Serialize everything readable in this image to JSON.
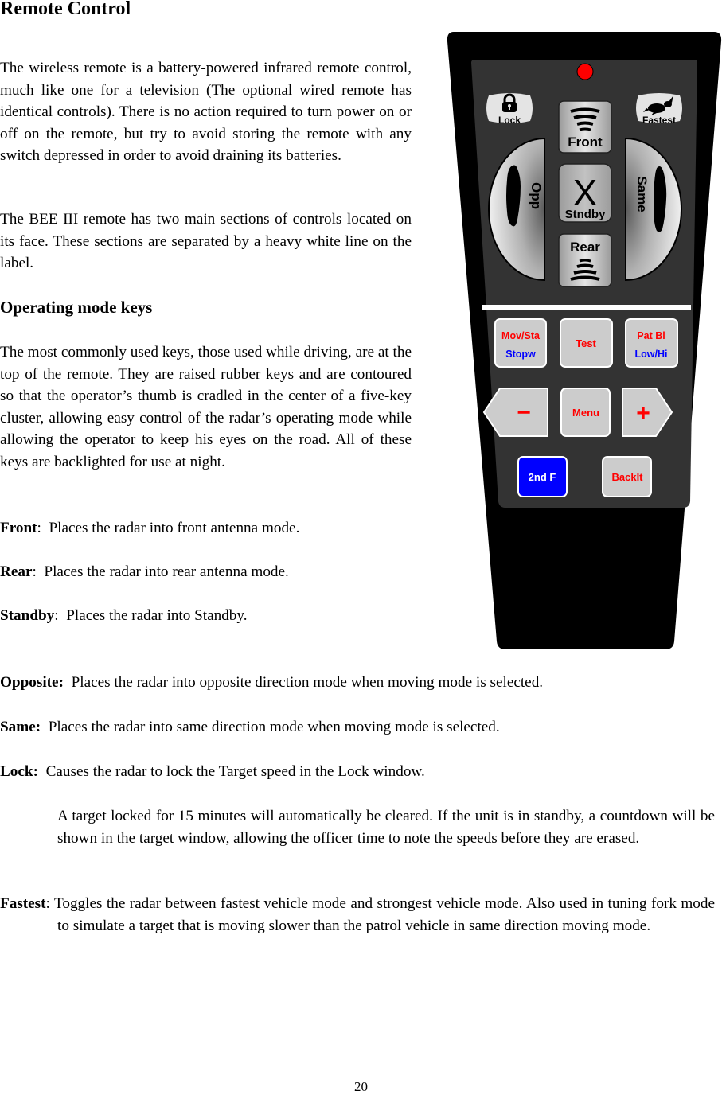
{
  "title": "Remote Control",
  "intro_paragraphs": [
    "The wireless remote is a battery-powered infrared remote control, much like one for a television (The optional wired remote has identical controls). There is no action required to turn power on or off on the remote, but try to avoid storing the remote with any switch depressed in order to avoid draining its batteries.",
    "The BEE III remote has two main sections of controls located on its face. These sections are separated by a heavy white line on the label."
  ],
  "section_heading": "Operating mode keys",
  "section_paragraph": "The most commonly used keys, those used while driving, are at the top of the remote.  They are raised rubber keys and are contoured so that the operator’s thumb is cradled in the center of a five-key cluster, allowing easy control of the radar’s operating mode while allowing the operator to keep his eyes on the road.  All of these keys are backlighted for use at night.",
  "definitions": [
    {
      "term": "Front",
      "sep": ":",
      "text": "  Places the radar into front antenna mode."
    },
    {
      "term": "Rear",
      "sep": ":",
      "text": "  Places the radar into rear antenna mode."
    },
    {
      "term": "Standby",
      "sep": ":",
      "text": "  Places the radar into Standby."
    },
    {
      "term": "Opposite:",
      "sep": "",
      "text": "  Places the radar into opposite direction mode when moving mode is selected."
    },
    {
      "term": "Same:",
      "sep": "",
      "text": "  Places the radar into same direction mode when moving mode is selected."
    },
    {
      "term": "Lock:",
      "sep": "",
      "text": "  Causes the radar to lock the Target speed in the Lock window."
    }
  ],
  "lock_note": "A target locked for 15 minutes will automatically be cleared.  If the unit is in standby, a countdown will be shown in the target window, allowing the officer time to note the speeds before they are erased.",
  "fastest": {
    "term": "Fastest",
    "sep": ":",
    "text": "  Toggles the radar between fastest vehicle mode and strongest vehicle mode.  Also used in tuning fork mode to simulate a target that is moving slower than the patrol vehicle in same direction moving mode."
  },
  "page_number": "20",
  "remote": {
    "colors": {
      "body": "#000000",
      "panel": "#333333",
      "led": "#ff0000",
      "key": "#cccccc",
      "red_text": "#ff0000",
      "blue_text": "#0000ff",
      "blue_key": "#0000ff",
      "divider": "#ffffff"
    },
    "keys": {
      "lock": {
        "label": "Lock",
        "icon": "padlock-icon"
      },
      "fastest": {
        "label": "Fastest",
        "icon": "rabbit-icon"
      },
      "front": {
        "label": "Front",
        "icon": "antenna-waves-icon"
      },
      "standby": {
        "label": "Stndby",
        "icon": "x-icon",
        "glyph": "X"
      },
      "rear": {
        "label": "Rear",
        "icon": "antenna-waves-icon"
      },
      "opp": {
        "label": "Opp",
        "icon": "car-icon"
      },
      "same": {
        "label": "Same",
        "icon": "car-icon"
      },
      "mov_sta": {
        "line1": "Mov/Sta",
        "line2": "Stopw"
      },
      "test": {
        "label": "Test"
      },
      "pat_bl": {
        "line1": "Pat Bl",
        "line2": "Low/Hi"
      },
      "minus": {
        "glyph": "−"
      },
      "menu": {
        "label": "Menu"
      },
      "plus": {
        "glyph": "+"
      },
      "second_f": {
        "label": "2nd F"
      },
      "backlt": {
        "label": "BackIt"
      }
    }
  }
}
